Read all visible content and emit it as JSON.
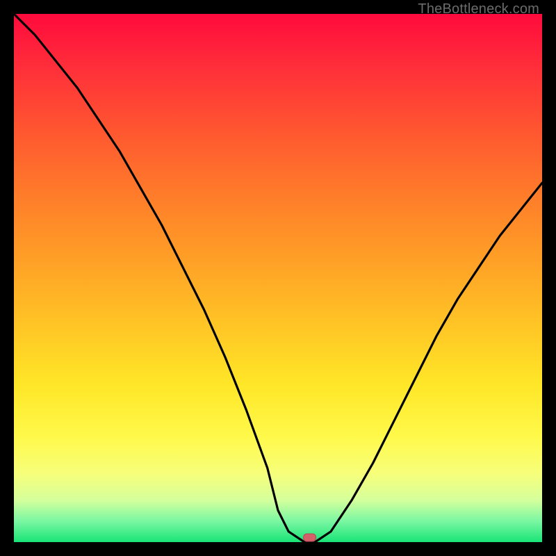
{
  "watermark": "TheBottleneck.com",
  "chart_data": {
    "type": "line",
    "title": "",
    "xlabel": "",
    "ylabel": "",
    "xlim": [
      0,
      100
    ],
    "ylim": [
      0,
      100
    ],
    "grid": false,
    "legend": false,
    "background_gradient": {
      "direction": "vertical",
      "stops": [
        {
          "pct": 0,
          "color": "#ff0a3c"
        },
        {
          "pct": 22,
          "color": "#ff5630"
        },
        {
          "pct": 46,
          "color": "#ff9e26"
        },
        {
          "pct": 70,
          "color": "#ffe627"
        },
        {
          "pct": 87,
          "color": "#f7ff7a"
        },
        {
          "pct": 96,
          "color": "#7bf7a2"
        },
        {
          "pct": 100,
          "color": "#18e477"
        }
      ]
    },
    "series": [
      {
        "name": "bottleneck-curve",
        "x": [
          0,
          4,
          8,
          12,
          16,
          20,
          24,
          28,
          32,
          36,
          40,
          44,
          48,
          50,
          52,
          55,
          57,
          60,
          64,
          68,
          72,
          76,
          80,
          84,
          88,
          92,
          96,
          100
        ],
        "y": [
          100,
          96,
          91,
          86,
          80,
          74,
          67,
          60,
          52,
          44,
          35,
          25,
          14,
          6,
          2,
          0,
          0,
          2,
          8,
          15,
          23,
          31,
          39,
          46,
          52,
          58,
          63,
          68
        ]
      }
    ],
    "marker": {
      "x": 56,
      "y": 0,
      "color": "#d4606a"
    }
  }
}
